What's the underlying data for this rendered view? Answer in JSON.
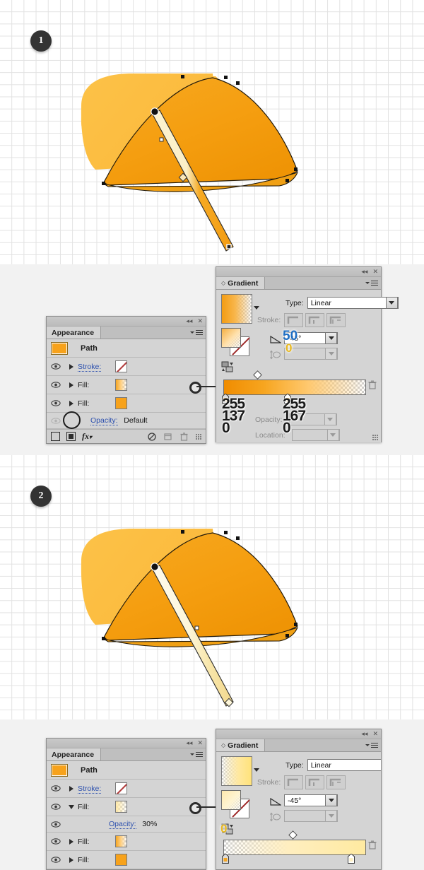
{
  "steps": [
    {
      "number": "1"
    },
    {
      "number": "2"
    }
  ],
  "appearance_panel_1": {
    "tab_label": "Appearance",
    "collapse_icon": "collapse-icon",
    "close_icon": "close-icon",
    "menu_icon": "panel-menu-icon",
    "rows": [
      {
        "name": "Path",
        "type": "target",
        "swatch": "orange-swatch"
      },
      {
        "label": "Stroke:",
        "swatch": "none-swatch",
        "expanded": "false",
        "visible": "true"
      },
      {
        "label": "Fill:",
        "swatch": "gradient-orange-swatch",
        "expanded": "false",
        "visible": "true"
      },
      {
        "label": "Fill:",
        "swatch": "solid-orange-swatch",
        "expanded": "false",
        "visible": "true"
      },
      {
        "label": "Opacity:",
        "value": "Default",
        "visible": "false"
      }
    ],
    "footer": {
      "new_stroke": "add-new-stroke",
      "new_fill": "add-new-fill",
      "fx": "fx",
      "clear": "clear-appearance",
      "duplicate": "duplicate-item",
      "delete": "delete-item"
    }
  },
  "gradient_panel_1": {
    "tab_label": "Gradient",
    "type_label": "Type:",
    "type_value": "Linear",
    "stroke_label": "Stroke:",
    "angle_value": "-45°",
    "aspect_value": "",
    "opacity_label": "Opacity:",
    "location_label": "Location:",
    "annotations": {
      "blue_number": "50",
      "gold_number": "0",
      "stop_left": {
        "r": "255",
        "g": "137",
        "b": "0"
      },
      "stop_right": {
        "r": "255",
        "g": "167",
        "b": "0"
      }
    }
  },
  "appearance_panel_2": {
    "tab_label": "Appearance",
    "rows": [
      {
        "name": "Path",
        "type": "target",
        "swatch": "orange-swatch"
      },
      {
        "label": "Stroke:",
        "swatch": "none-swatch",
        "expanded": "false",
        "visible": "true"
      },
      {
        "label": "Fill:",
        "swatch": "gradient-yellow-swatch",
        "expanded": "true",
        "visible": "true"
      },
      {
        "label": "Opacity:",
        "value": "30%",
        "visible": "true"
      },
      {
        "label": "Fill:",
        "swatch": "gradient-orange-swatch",
        "expanded": "false",
        "visible": "true"
      },
      {
        "label": "Fill:",
        "swatch": "solid-orange-swatch",
        "expanded": "false",
        "visible": "true"
      }
    ]
  },
  "gradient_panel_2": {
    "tab_label": "Gradient",
    "type_label": "Type:",
    "type_value": "Linear",
    "stroke_label": "Stroke:",
    "angle_value": "-45°",
    "annotations": {
      "gold_number": "0"
    }
  },
  "colors": {
    "canvas_bg": "#ffffff",
    "grid_line": "#e2e2e2",
    "panel_bg": "#f2f2f2",
    "ai_panel_bg": "#d4d4d4",
    "accent_link": "#2b4fae",
    "umbrella_light": "#fbbd3f",
    "umbrella_dark": "#f09a0c",
    "badge_bg": "#333333"
  }
}
